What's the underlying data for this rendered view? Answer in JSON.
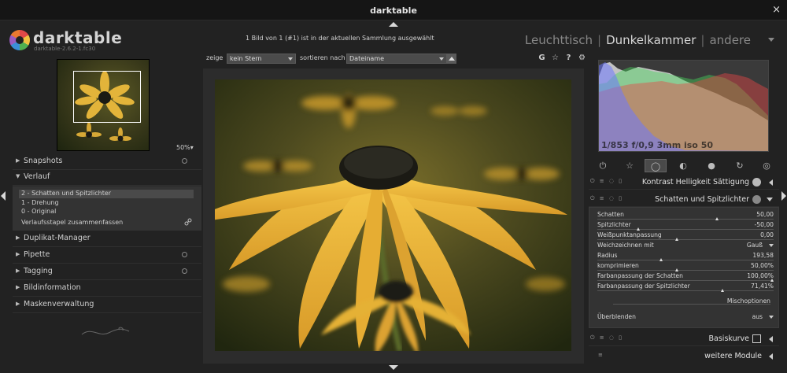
{
  "window": {
    "title": "darktable",
    "close": "×"
  },
  "header": {
    "logo_name": "darktable",
    "logo_version": "darktable-2.6.2-1.fc30",
    "collection_info": "1 Bild von 1 (#1) ist in der aktuellen Sammlung ausgewählt",
    "views": [
      "Leuchttisch",
      "Dunkelkammer",
      "andere"
    ],
    "active_view": "Dunkelkammer"
  },
  "left": {
    "zoom": "50%▾",
    "snapshots": "Snapshots",
    "verlauf": "Verlauf",
    "history": [
      {
        "label": "2 - Schatten und Spitzlichter",
        "selected": true
      },
      {
        "label": "1 - Drehung",
        "selected": false
      },
      {
        "label": "0 - Original",
        "selected": false
      }
    ],
    "compress": "Verlaufsstapel zusammenfassen",
    "sections": [
      "Duplikat-Manager",
      "Pipette",
      "Tagging",
      "Bildinformation",
      "Maskenverwaltung"
    ]
  },
  "filter": {
    "show_label": "zeige",
    "show_value": "kein Stern",
    "sort_label": "sortieren nach",
    "sort_value": "Dateiname",
    "icons": [
      "G",
      "☆",
      "?",
      "⚙"
    ]
  },
  "right": {
    "exif": "1/853 f/0,9 3mm iso 50",
    "groups": [
      "power-icon",
      "star-icon",
      "circle-icon",
      "contrast-icon",
      "color-icon",
      "correction-icon",
      "effect-icon"
    ],
    "modules": {
      "contrast": "Kontrast Helligkeit Sättigung",
      "shadows": "Schatten und Spitzlichter",
      "basecurve": "Basiskurve",
      "more": "weitere Module"
    },
    "params": [
      {
        "label": "Schatten",
        "value": "50,00",
        "pos": 0.68
      },
      {
        "label": "Spitzlichter",
        "value": "-50,00",
        "pos": 0.23
      },
      {
        "label": "Weißpunktanpassung",
        "value": "0,00",
        "pos": 0.45
      },
      {
        "label": "Radius",
        "value": "193,58",
        "pos": 0.36
      },
      {
        "label": "komprimieren",
        "value": "50,00%",
        "pos": 0.45
      },
      {
        "label": "Farbanpassung der Schatten",
        "value": "100,00%",
        "pos": 0.99
      },
      {
        "label": "Farbanpassung der Spitzlichter",
        "value": "71,41%",
        "pos": 0.71
      }
    ],
    "blur_label": "Weichzeichnen mit",
    "blur_value": "Gauß",
    "mix_label": "Mischoptionen",
    "blend_label": "Überblenden",
    "blend_value": "aus"
  },
  "colors": {
    "accent": "#e6c04a",
    "panel": "#333333",
    "background": "#222222"
  }
}
